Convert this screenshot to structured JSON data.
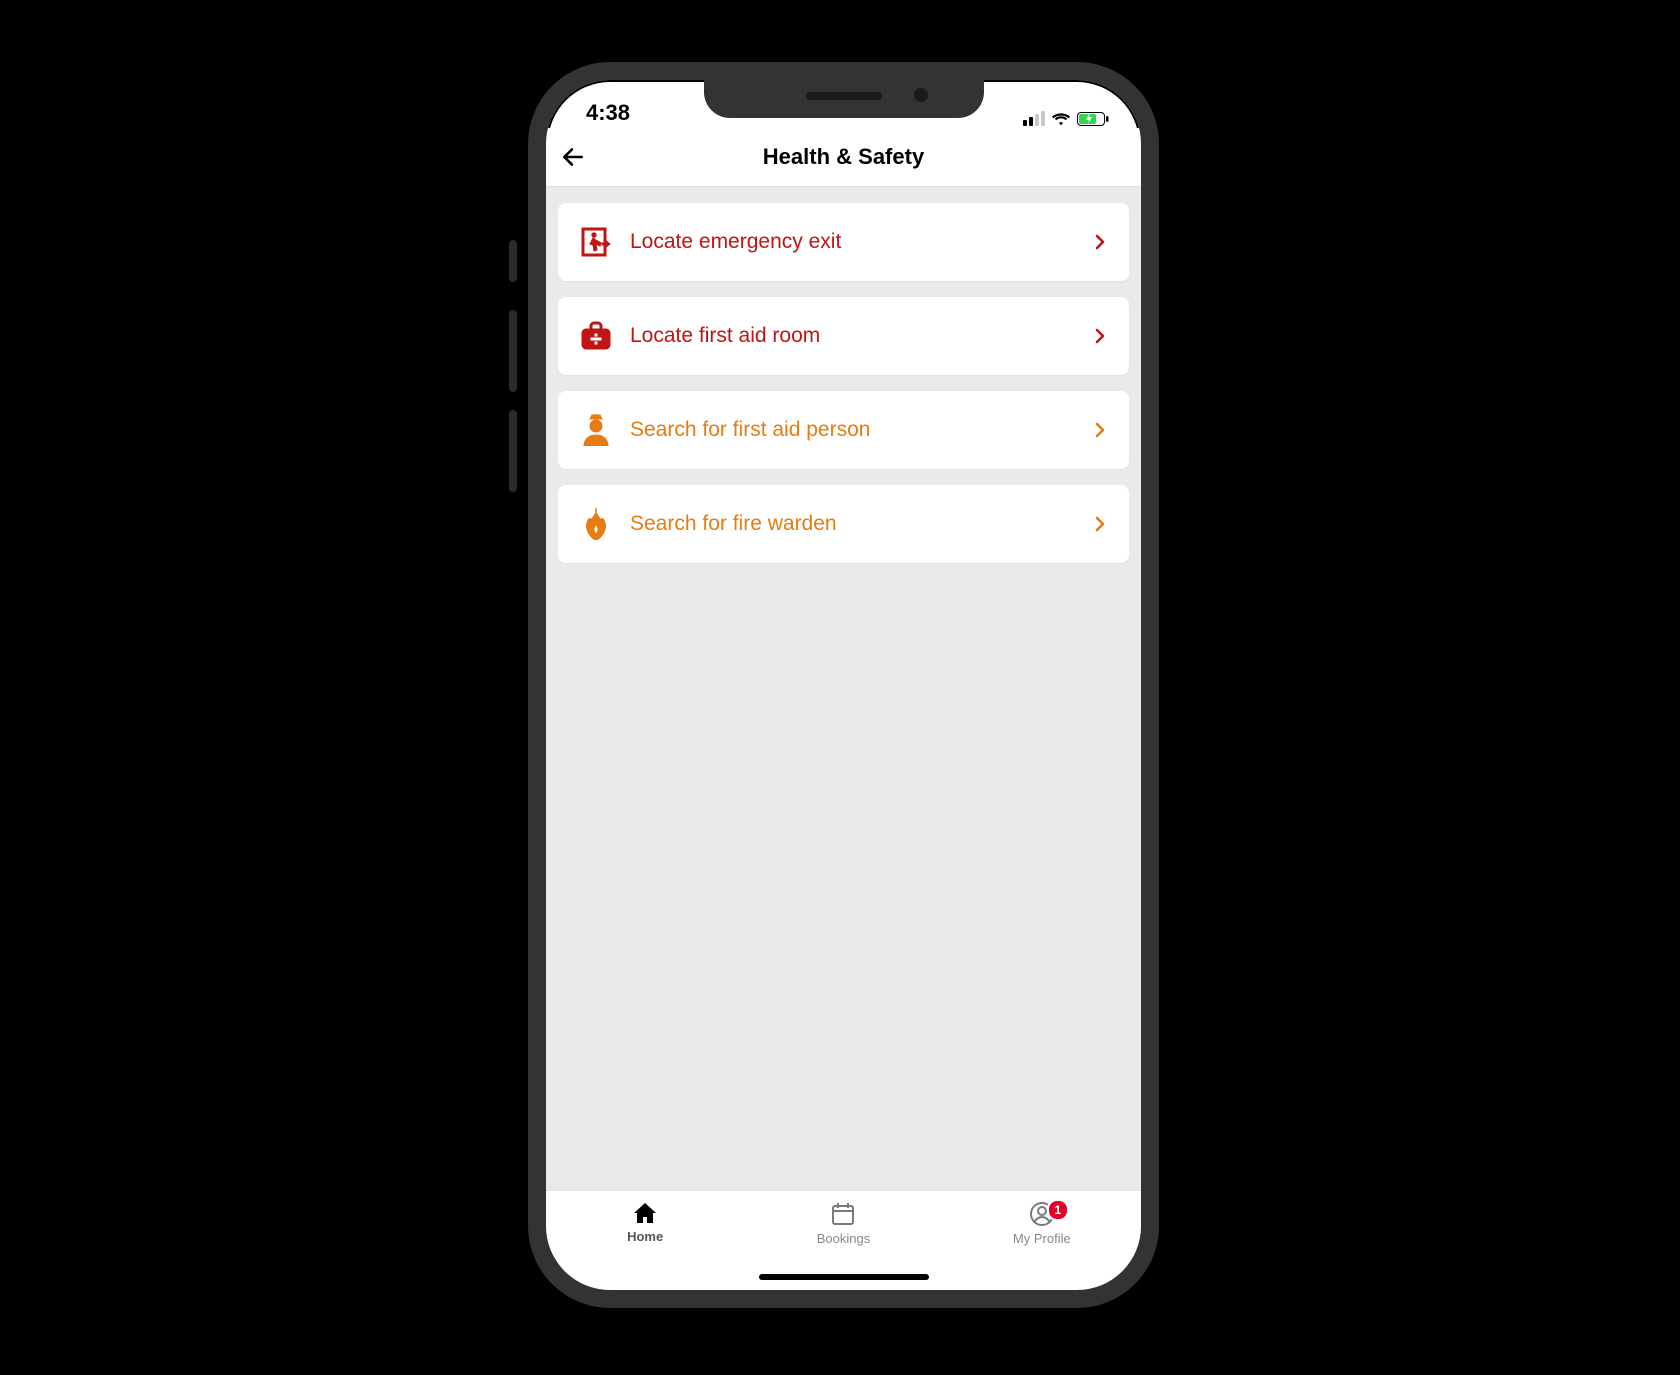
{
  "statusbar": {
    "time": "4:38"
  },
  "header": {
    "title": "Health & Safety"
  },
  "items": [
    {
      "label": "Locate emergency exit",
      "icon": "exit-icon",
      "color": "red"
    },
    {
      "label": "Locate first aid room",
      "icon": "first-aid-icon",
      "color": "red"
    },
    {
      "label": "Search for first aid person",
      "icon": "medic-person-icon",
      "color": "orange"
    },
    {
      "label": "Search for fire warden",
      "icon": "flame-icon",
      "color": "orange"
    }
  ],
  "tabs": {
    "home": {
      "label": "Home"
    },
    "bookings": {
      "label": "Bookings"
    },
    "profile": {
      "label": "My Profile",
      "badge": "1"
    }
  },
  "colors": {
    "red": "#c11515",
    "orange": "#e87b12",
    "badge": "#e3002b"
  }
}
